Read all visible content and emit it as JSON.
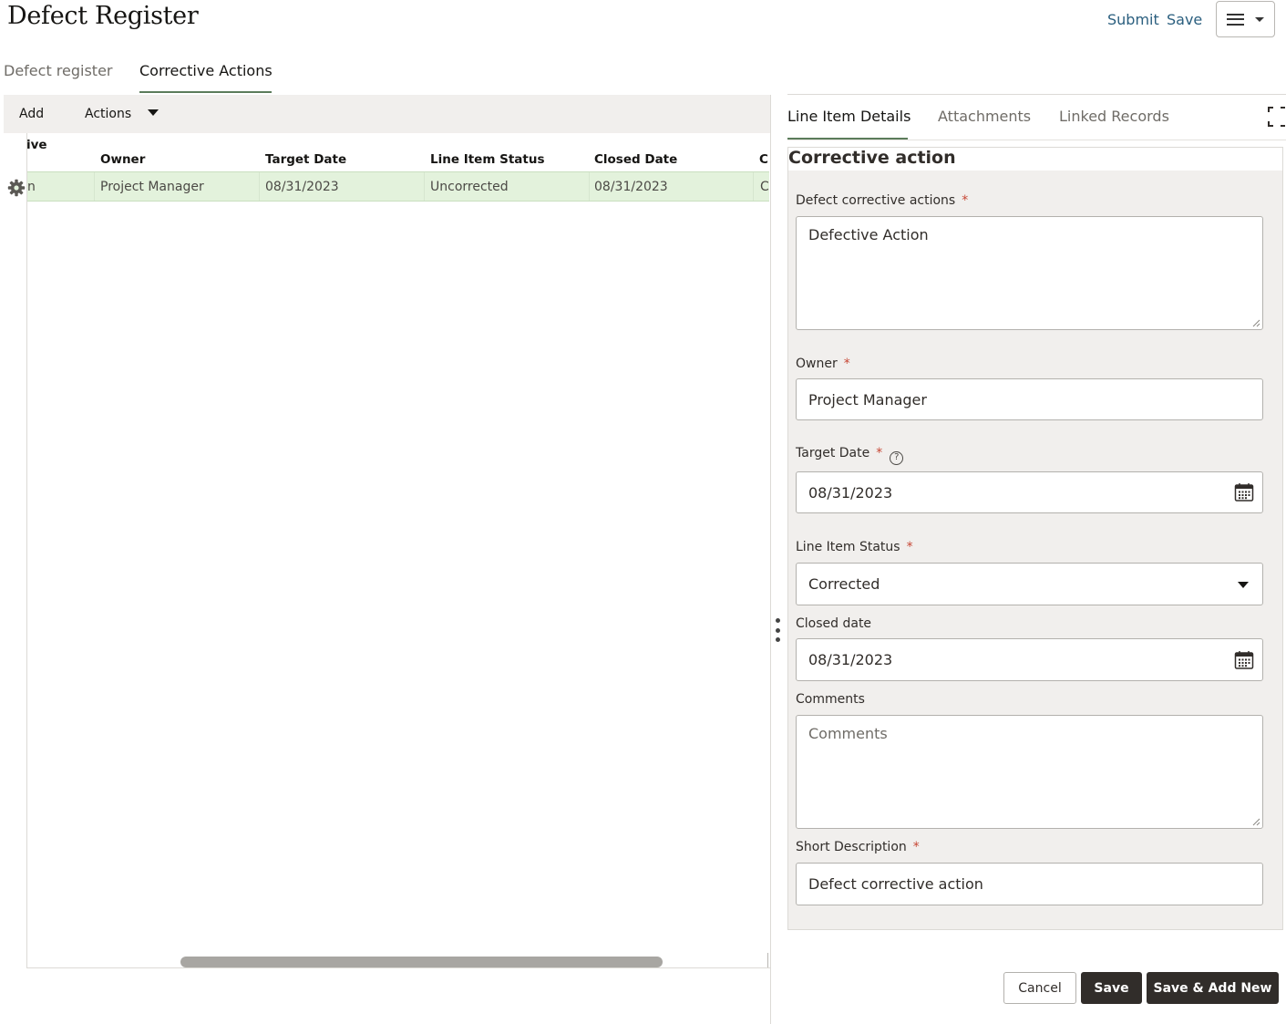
{
  "header": {
    "title": "Defect Register",
    "submit_label": "Submit",
    "save_label": "Save"
  },
  "tabs": [
    {
      "label": "Defect register",
      "active": false
    },
    {
      "label": "Corrective Actions",
      "active": true
    }
  ],
  "grid": {
    "toolbar": {
      "add_label": "Add",
      "actions_label": "Actions"
    },
    "partial_header_top": "ive",
    "columns": [
      "Owner",
      "Target Date",
      "Line Item Status",
      "Closed Date",
      "C"
    ],
    "rows": [
      {
        "partial_first": "n",
        "owner": "Project Manager",
        "target_date": "08/31/2023",
        "status": "Uncorrected",
        "closed_date": "08/31/2023",
        "partial_last": "C"
      }
    ]
  },
  "detail": {
    "tabs": [
      "Line Item Details",
      "Attachments",
      "Linked Records"
    ],
    "section_title": "Corrective action",
    "fields": {
      "corrective_actions": {
        "label": "Defect corrective actions",
        "value": "Defective Action"
      },
      "owner": {
        "label": "Owner",
        "value": "Project Manager"
      },
      "target_date": {
        "label": "Target Date",
        "value": "08/31/2023"
      },
      "line_item_status": {
        "label": "Line Item Status",
        "value": "Corrected"
      },
      "closed_date": {
        "label": "Closed date",
        "value": "08/31/2023"
      },
      "comments": {
        "label": "Comments",
        "placeholder": "Comments"
      },
      "short_description": {
        "label": "Short Description",
        "value": "Defect corrective action"
      }
    },
    "required_mark": "*",
    "help_glyph": "?"
  },
  "footer": {
    "cancel_label": "Cancel",
    "save_label": "Save",
    "save_add_new_label": "Save & Add New"
  },
  "colors": {
    "accent_underline": "#5b7c5b",
    "row_highlight": "#e3f2dc",
    "link": "#2b5f7f",
    "primary_button": "#312d2a",
    "required": "#c74634"
  }
}
